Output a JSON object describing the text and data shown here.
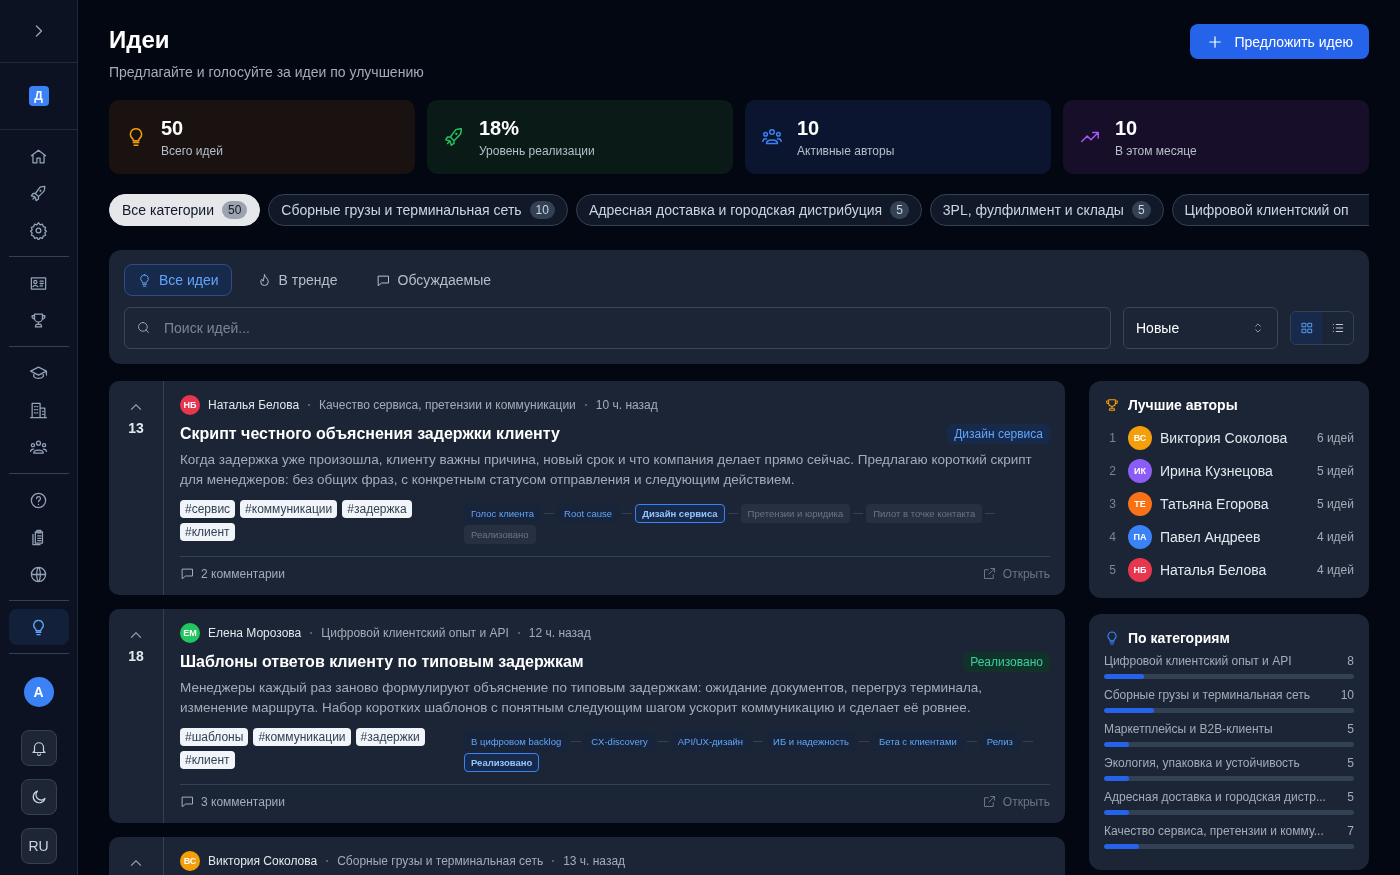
{
  "sidebar": {
    "logo": "Д",
    "groups": [
      [
        {
          "selected": false
        },
        {
          "selected": false
        },
        {
          "selected": false
        }
      ],
      [
        {
          "selected": false
        },
        {
          "selected": false
        }
      ],
      [
        {
          "selected": false
        },
        {
          "selected": false
        },
        {
          "selected": false
        }
      ],
      [
        {
          "selected": false
        },
        {
          "selected": false
        },
        {
          "selected": false
        }
      ],
      [
        {
          "selected": true
        }
      ]
    ],
    "avatar": "A",
    "language": "RU"
  },
  "header": {
    "title": "Идеи",
    "subtitle": "Предлагайте и голосуйте за идеи по улучшению",
    "action": "Предложить идею"
  },
  "stats": [
    {
      "kind": "total",
      "value": "50",
      "label": "Всего идей"
    },
    {
      "kind": "rate",
      "value": "18%",
      "label": "Уровень реализации"
    },
    {
      "kind": "authors",
      "value": "10",
      "label": "Активные авторы"
    },
    {
      "kind": "month",
      "value": "10",
      "label": "В этом месяце"
    }
  ],
  "categories": [
    {
      "label": "Все категории",
      "count": "50",
      "selected": true
    },
    {
      "label": "Сборные грузы и терминальная сеть",
      "count": "10",
      "selected": false
    },
    {
      "label": "Адресная доставка и городская дистрибуция",
      "count": "5",
      "selected": false
    },
    {
      "label": "3PL, фулфилмент и склады",
      "count": "5",
      "selected": false
    },
    {
      "label": "Цифровой клиентский оп",
      "selected": false
    }
  ],
  "filters": {
    "tabs": [
      {
        "label": "Все идеи",
        "selected": true
      },
      {
        "label": "В тренде",
        "selected": false
      },
      {
        "label": "Обсуждаемые",
        "selected": false
      }
    ],
    "search": {
      "placeholder": "Поиск идей..."
    },
    "sort": "Новые",
    "view_modes": [
      {
        "selected": true
      },
      {
        "selected": false
      }
    ]
  },
  "ideas": [
    {
      "votes": "13",
      "initials": "НБ",
      "color": "#e8364f",
      "author": "Наталья Белова",
      "category": "Качество сервиса, претензии и коммуникации",
      "time": "10 ч. назад",
      "title": "Скрипт честного объяснения задержки клиенту",
      "badge": {
        "kind": "progress",
        "label": "Дизайн сервиса"
      },
      "description": "Когда задержка уже произошла, клиенту важны причина, новый срок и что компания делает прямо сейчас. Предлагаю короткий скрипт для менеджеров: без общих фраз, с конкретным статусом отправления и следующим действием.",
      "tags": [
        "#сервис",
        "#коммуникации",
        "#задержка",
        "#клиент"
      ],
      "stages": [
        {
          "label": "Голос клиента",
          "kind": "done"
        },
        {
          "label": "Root cause",
          "kind": "done"
        },
        {
          "label": "Дизайн сервиса",
          "kind": "current"
        },
        {
          "label": "Претензии и юридика",
          "kind": "pending"
        },
        {
          "label": "Пилот в точке контакта",
          "kind": "pending"
        },
        {
          "label": "Реализовано",
          "kind": "pending"
        }
      ],
      "comments": "2 комментарии",
      "open": "Открыть"
    },
    {
      "votes": "18",
      "initials": "ЕМ",
      "color": "#22c55e",
      "author": "Елена Морозова",
      "category": "Цифровой клиентский опыт и API",
      "time": "12 ч. назад",
      "title": "Шаблоны ответов клиенту по типовым задержкам",
      "badge": {
        "kind": "done",
        "label": "Реализовано"
      },
      "description": "Менеджеры каждый раз заново формулируют объяснение по типовым задержкам: ожидание документов, перегруз терминала, изменение маршрута. Набор коротких шаблонов с понятным следующим шагом ускорит коммуникацию и сделает её ровнее.",
      "tags": [
        "#шаблоны",
        "#коммуникации",
        "#задержки",
        "#клиент"
      ],
      "stages": [
        {
          "label": "В цифровом backlog",
          "kind": "done"
        },
        {
          "label": "CX-discovery",
          "kind": "done"
        },
        {
          "label": "API/UX-дизайн",
          "kind": "done"
        },
        {
          "label": "ИБ и надежность",
          "kind": "done"
        },
        {
          "label": "Бета с клиентами",
          "kind": "done"
        },
        {
          "label": "Релиз",
          "kind": "done"
        },
        {
          "label": "Реализовано",
          "kind": "current"
        }
      ],
      "comments": "3 комментарии",
      "open": "Открыть"
    },
    {
      "initials": "ВС",
      "color": "#f59e0b",
      "author": "Виктория Соколова",
      "category": "Сборные грузы и терминальная сеть",
      "time": "13 ч. назад"
    }
  ],
  "top_authors": {
    "title": "Лучшие авторы",
    "items": [
      {
        "rank": "1",
        "initials": "ВС",
        "color": "#f59e0b",
        "name": "Виктория Соколова",
        "count": "6 идей"
      },
      {
        "rank": "2",
        "initials": "ИК",
        "color": "#8b5cf6",
        "name": "Ирина Кузнецова",
        "count": "5 идей"
      },
      {
        "rank": "3",
        "initials": "ТЕ",
        "color": "#f97316",
        "name": "Татьяна Егорова",
        "count": "5 идей"
      },
      {
        "rank": "4",
        "initials": "ПА",
        "color": "#3b82f6",
        "name": "Павел Андреев",
        "count": "4 идей"
      },
      {
        "rank": "5",
        "initials": "НБ",
        "color": "#e8364f",
        "name": "Наталья Белова",
        "count": "4 идей"
      }
    ]
  },
  "by_category": {
    "title": "По категориям",
    "items": [
      {
        "label": "Цифровой клиентский опыт и API",
        "count": "8",
        "level": 0.16
      },
      {
        "label": "Сборные грузы и терминальная сеть",
        "count": "10",
        "level": 0.2
      },
      {
        "label": "Маркетплейсы и B2B-клиенты",
        "count": "5",
        "level": 0.1
      },
      {
        "label": "Экология, упаковка и устойчивость",
        "count": "5",
        "level": 0.1
      },
      {
        "label": "Адресная доставка и городская дистр...",
        "count": "5",
        "level": 0.1
      },
      {
        "label": "Качество сервиса, претензии и комму...",
        "count": "7",
        "level": 0.14
      }
    ]
  }
}
